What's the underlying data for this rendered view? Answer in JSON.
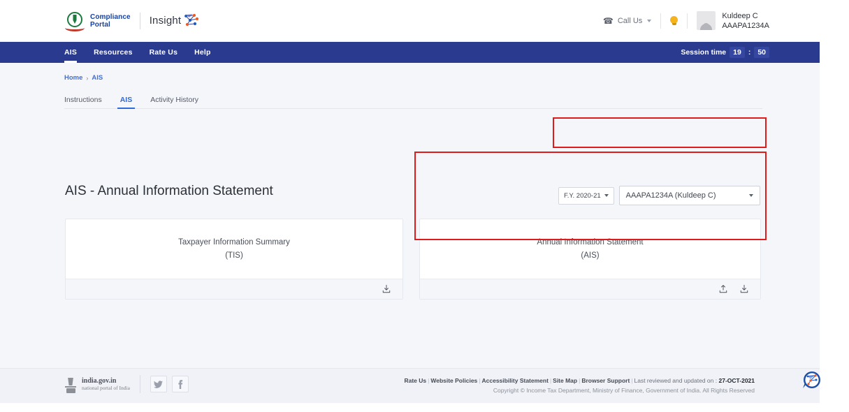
{
  "header": {
    "brand_line1": "Compliance",
    "brand_line2": "Portal",
    "insight_label": "Insight",
    "insight_mark_icon": "network-graph-icon",
    "emblem_icon": "india-emblem-icon",
    "call_us": "Call Us",
    "call_icon": "phone-icon",
    "bulb_icon": "lightbulb-icon",
    "avatar_icon": "user-avatar-icon",
    "user_name": "Kuldeep C",
    "user_pan": "AAAPA1234A"
  },
  "nav": {
    "items": [
      {
        "label": "AIS",
        "active": true
      },
      {
        "label": "Resources",
        "active": false
      },
      {
        "label": "Rate Us",
        "active": false
      },
      {
        "label": "Help",
        "active": false
      }
    ],
    "session_label": "Session time",
    "session_minutes": "19",
    "session_separator": ":",
    "session_seconds": "50"
  },
  "breadcrumb": {
    "home": "Home",
    "separator": "›",
    "current": "AIS"
  },
  "tabs": [
    {
      "label": "Instructions",
      "active": false
    },
    {
      "label": "AIS",
      "active": true
    },
    {
      "label": "Activity History",
      "active": false
    }
  ],
  "main": {
    "page_title": "AIS - Annual Information Statement",
    "filters": {
      "financial_year": "F.Y. 2020-21",
      "fy_caret_icon": "chevron-down-icon",
      "pan_selected": "AAAPA1234A (Kuldeep C)",
      "pan_caret_icon": "chevron-down-icon"
    },
    "cards": [
      {
        "title": "Taxpayer Information Summary",
        "subtitle": "(TIS)",
        "actions": [
          {
            "icon": "download-icon",
            "name": "download-tis-button"
          }
        ]
      },
      {
        "title": "Annual Information Statement",
        "subtitle": "(AIS)",
        "actions": [
          {
            "icon": "upload-icon",
            "name": "upload-ais-button"
          },
          {
            "icon": "download-icon",
            "name": "download-ais-button"
          }
        ]
      }
    ]
  },
  "footer": {
    "gov_title": "india.gov.in",
    "gov_subtitle": "national portal of India",
    "gov_emblem_icon": "india-emblem-gray-icon",
    "social": [
      {
        "icon": "twitter-icon",
        "glyph": "🐦",
        "name": "twitter-link"
      },
      {
        "icon": "facebook-icon",
        "glyph": "f",
        "name": "facebook-link"
      }
    ],
    "links": [
      "Rate Us",
      "Website Policies",
      "Accessibility Statement",
      "Site Map",
      "Browser Support"
    ],
    "reviewed_label": "Last reviewed and updated on :",
    "reviewed_date": "27-OCT-2021",
    "copyright": "Copyright © Income Tax Department, Ministry of Finance, Government of India. All Rights Reserved",
    "chat_badge_icon": "insight-chat-badge-icon"
  },
  "annotations": {
    "highlight_color": "#e01b1b",
    "boxes": [
      {
        "name": "filters-highlight"
      },
      {
        "name": "ais-card-highlight"
      }
    ]
  },
  "colors": {
    "navbar": "#2a3a8f",
    "accent_blue": "#2f6ad9",
    "brand_blue": "#17409e",
    "page_bg": "#f5f6fa"
  }
}
